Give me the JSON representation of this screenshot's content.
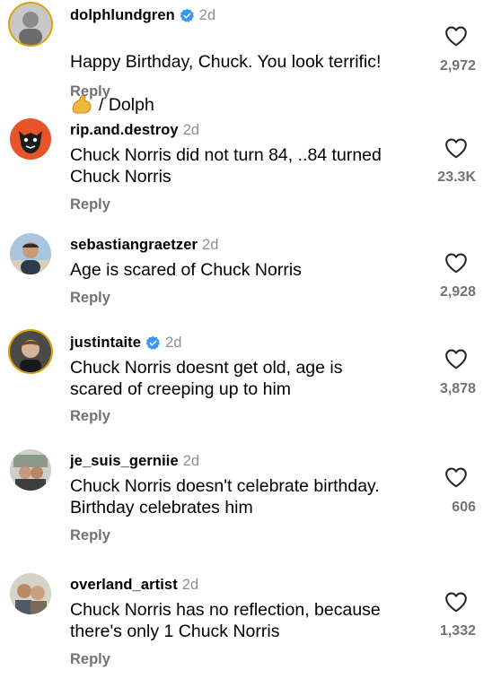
{
  "comments": [
    {
      "username": "dolphlundgren",
      "verified": true,
      "time": "2d",
      "text": "Happy Birthday, Chuck. You look terrific!",
      "text2": "/ Dolph",
      "emoji": "flexed-biceps",
      "reply": "Reply",
      "likes": "2,972"
    },
    {
      "username": "rip.and.destroy",
      "verified": false,
      "time": "2d",
      "text": "Chuck Norris did not turn 84, ..84 turned\nChuck Norris",
      "reply": "Reply",
      "likes": "23.3K"
    },
    {
      "username": "sebastiangraetzer",
      "verified": false,
      "time": "2d",
      "text": "Age is scared of Chuck Norris",
      "reply": "Reply",
      "likes": "2,928"
    },
    {
      "username": "justintaite",
      "verified": true,
      "time": "2d",
      "text": "Chuck Norris doesnt get old, age is\nscared of creeping up to him",
      "reply": "Reply",
      "likes": "3,878"
    },
    {
      "username": "je_suis_gerniie",
      "verified": false,
      "time": "2d",
      "text": "Chuck Norris doesn't celebrate birthday.\nBirthday celebrates him",
      "reply": "Reply",
      "likes": "606"
    },
    {
      "username": "overland_artist",
      "verified": false,
      "time": "2d",
      "text": "Chuck Norris has no reflection, because\nthere's only 1 Chuck Norris",
      "reply": "Reply",
      "likes": "1,332"
    }
  ],
  "colors": {
    "verified_badge": "#3897f0",
    "muted_text": "#737373",
    "time_text": "#8e8e8e"
  },
  "icons": {
    "like": "heart-outline-icon",
    "verified": "verified-badge-icon"
  }
}
